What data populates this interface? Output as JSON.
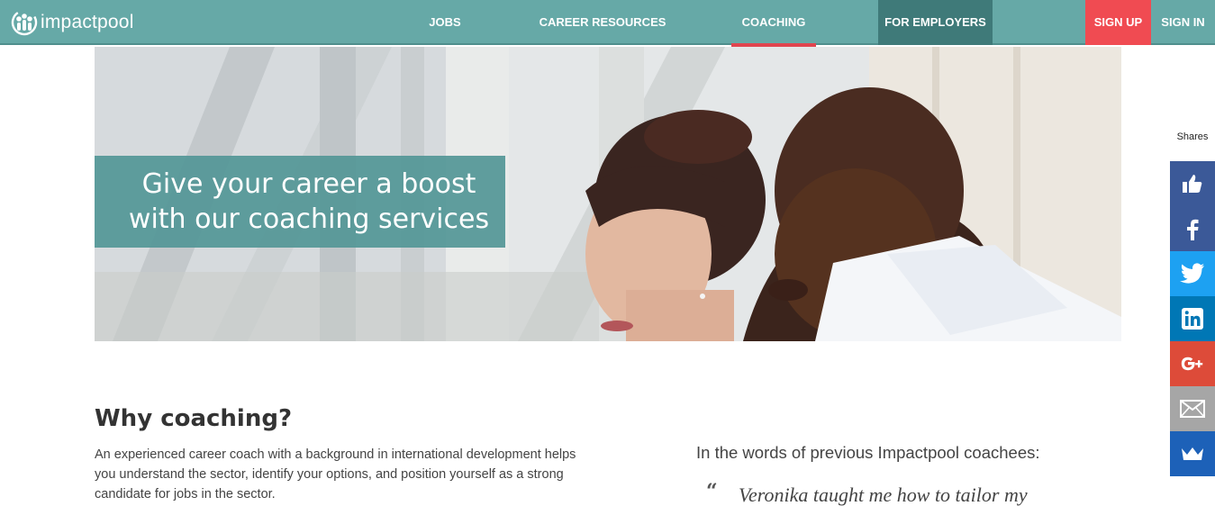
{
  "brand": {
    "name": "impactpool"
  },
  "nav": {
    "jobs": "JOBS",
    "career_resources": "CAREER RESOURCES",
    "coaching": "COACHING",
    "for_employers": "FOR EMPLOYERS",
    "sign_up": "SIGN UP",
    "sign_in": "SIGN IN"
  },
  "hero": {
    "line1": "Give your career a boost",
    "line2": "with our coaching services"
  },
  "why": {
    "title": "Why coaching?",
    "text": "An experienced career coach with a background in international development helps you understand the sector, identify your options, and position yourself as a strong candidate for jobs in the sector."
  },
  "testimonials": {
    "title": "In the words of previous Impactpool coachees:",
    "quote_mark": "“",
    "quote": "Veronika taught me how to tailor my"
  },
  "share": {
    "label": "Shares",
    "buttons": [
      {
        "icon": "thumbs-up-icon",
        "color": "#3b5998"
      },
      {
        "icon": "facebook-icon",
        "color": "#3b5998"
      },
      {
        "icon": "twitter-icon",
        "color": "#1da1f2"
      },
      {
        "icon": "linkedin-icon",
        "color": "#0077b5"
      },
      {
        "icon": "google-plus-icon",
        "color": "#dd4b39"
      },
      {
        "icon": "email-icon",
        "color": "#a6a6a6"
      },
      {
        "icon": "crown-icon",
        "color": "#1d61b8"
      }
    ]
  },
  "colors": {
    "nav_bg": "#66a9a7",
    "active_underline": "#e0454f",
    "employers_bg": "#3f7a79",
    "signup_bg": "#f04b52"
  }
}
